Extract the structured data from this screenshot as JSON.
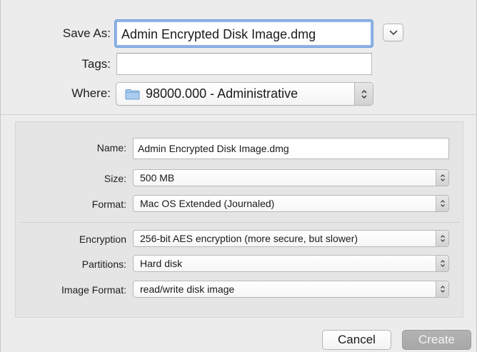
{
  "save_as": {
    "label": "Save As:",
    "value": "Admin Encrypted Disk Image.dmg"
  },
  "tags": {
    "label": "Tags:",
    "value": ""
  },
  "where": {
    "label": "Where:",
    "value": "98000.000 - Administrative",
    "icon": "folder-icon"
  },
  "expand_icon": "chevron-down-icon",
  "options": {
    "name": {
      "label": "Name:",
      "value": "Admin Encrypted Disk Image.dmg"
    },
    "size": {
      "label": "Size:",
      "value": "500 MB"
    },
    "format": {
      "label": "Format:",
      "value": "Mac OS Extended (Journaled)"
    },
    "encryption": {
      "label": "Encryption",
      "value": "256-bit AES encryption (more secure, but slower)"
    },
    "partitions": {
      "label": "Partitions:",
      "value": "Hard disk"
    },
    "image_format": {
      "label": "Image Format:",
      "value": "read/write disk image"
    }
  },
  "buttons": {
    "cancel": "Cancel",
    "create": "Create"
  },
  "colors": {
    "focus_ring": "#8fb3e6",
    "folder_icon": "#9cc4ec",
    "disabled_button": "#aeaeae"
  }
}
